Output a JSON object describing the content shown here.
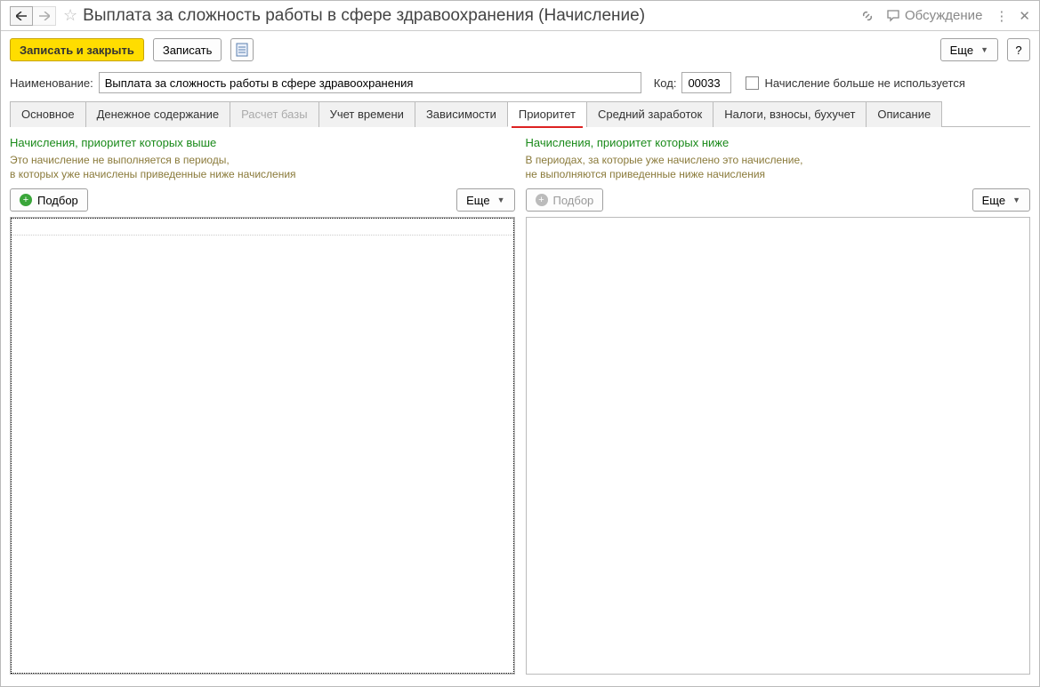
{
  "header": {
    "title": "Выплата за сложность работы в сфере здравоохранения (Начисление)",
    "discussion": "Обсуждение"
  },
  "toolbar": {
    "save_close": "Записать и закрыть",
    "save": "Записать",
    "more": "Еще",
    "help": "?"
  },
  "form": {
    "name_label": "Наименование:",
    "name_value": "Выплата за сложность работы в сфере здравоохранения",
    "code_label": "Код:",
    "code_value": "00033",
    "not_used_label": "Начисление больше не используется"
  },
  "tabs": [
    {
      "label": "Основное",
      "active": false
    },
    {
      "label": "Денежное содержание",
      "active": false
    },
    {
      "label": "Расчет базы",
      "active": false,
      "disabled": true
    },
    {
      "label": "Учет времени",
      "active": false
    },
    {
      "label": "Зависимости",
      "active": false
    },
    {
      "label": "Приоритет",
      "active": true
    },
    {
      "label": "Средний заработок",
      "active": false
    },
    {
      "label": "Налоги, взносы, бухучет",
      "active": false
    },
    {
      "label": "Описание",
      "active": false
    }
  ],
  "priority": {
    "higher": {
      "title": "Начисления, приоритет которых выше",
      "desc1": "Это начисление не выполняется в периоды,",
      "desc2": "в которых уже начислены приведенные ниже начисления",
      "pick": "Подбор",
      "more": "Еще"
    },
    "lower": {
      "title": "Начисления, приоритет которых ниже",
      "desc1": "В периодах, за которые уже начислено это начисление,",
      "desc2": "не выполняются приведенные ниже начисления",
      "pick": "Подбор",
      "more": "Еще"
    }
  }
}
